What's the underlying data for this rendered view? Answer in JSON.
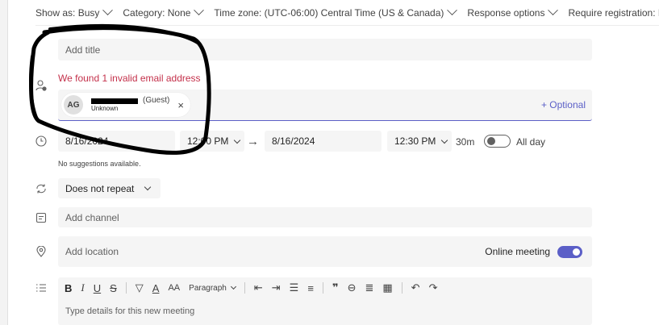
{
  "topbar": {
    "show_as": "Show as: Busy",
    "category": "Category: None",
    "timezone": "Time zone: (UTC-06:00) Central Time (US & Canada)",
    "response": "Response options",
    "registration": "Require registration: None"
  },
  "title": {
    "placeholder": "Add title"
  },
  "attendees": {
    "error": "We found 1 invalid email address",
    "chip": {
      "initials": "AG",
      "guest": "(Guest)",
      "status": "Unknown"
    },
    "optional": "+ Optional"
  },
  "schedule": {
    "start_date": "8/16/2024",
    "start_time": "12:00 PM",
    "end_date": "8/16/2024",
    "end_time": "12:30 PM",
    "duration": "30m",
    "all_day": "All day",
    "suggestions": "No suggestions available."
  },
  "repeat": {
    "value": "Does not repeat"
  },
  "channel": {
    "placeholder": "Add channel"
  },
  "location": {
    "placeholder": "Add location",
    "online_label": "Online meeting",
    "online_enabled": true
  },
  "editor": {
    "paragraph": "Paragraph",
    "placeholder": "Type details for this new meeting"
  },
  "colors": {
    "accent": "#5b5fc7",
    "error": "#c4314b"
  }
}
